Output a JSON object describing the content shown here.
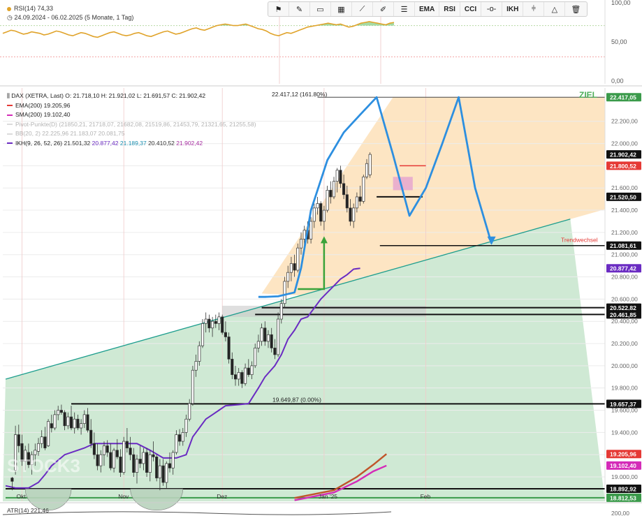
{
  "rsi_panel": {
    "label": "RSI(14)",
    "value": "74,33",
    "range_text": "24.09.2024 - 06.02.2025  (5 Monate, 1 Tag)",
    "levels": [
      "100,00",
      "50,00",
      "0,00"
    ]
  },
  "toolbar": {
    "icons": [
      "flag-icon",
      "pencil-icon",
      "rectangle-icon",
      "pattern-icon",
      "trend-line-icon",
      "brush-icon",
      "lines-icon"
    ],
    "texts": [
      "EMA",
      "RSI",
      "CCI"
    ],
    "icons2": [
      "dash-dot-icon"
    ],
    "texts2": [
      "IKH"
    ],
    "icons3": [
      "level-icon",
      "triangle-icon",
      "trash-icon"
    ]
  },
  "legend": {
    "title": "DAX (XETRA, Last)  O: 21.718,10  H: 21.921,02  L: 21.691,57  C: 21.902,42",
    "ema": "EMA(200)  19.205,96",
    "sma": "SMA(200)  19.102,40",
    "pivot": "Pivot-Punkte(D)  (21850,21,  21718,07,  21682,08,  21519,86,  21453,79,  21321,65,  21255,58)",
    "bb": "BB(20, 2)  22.225,96  21.183,07  20.081,75",
    "ikh_label": "IKH(9, 26, 52, 26)",
    "ikh_vals": [
      "21.501,32",
      "20.877,42",
      "21.189,37",
      "20.410,52",
      "21.902,42"
    ]
  },
  "annotations": {
    "ziel": "ZIEL",
    "fib_top": "22.417,12 (161.80%)",
    "fib_low": "19.649,87 (0.00%)",
    "trendwechsel": "Trendwechsel"
  },
  "atr": {
    "label": "ATR(14)",
    "value": "221,46",
    "scale_top": "200,00"
  },
  "watermark": "STOCK3",
  "colors": {
    "candle_up": "#ffffff",
    "candle_down": "#222222",
    "ikh": "#6a2bc2",
    "ema": "#c0552a",
    "sma": "#d42bb8",
    "projection": "#2d8fe0",
    "green_zone": "#cfe9d4",
    "orange_zone": "#fde2bd",
    "trendline": "#1e9e8e",
    "green_arrow": "#3aa33a",
    "rsi_line": "#e0a32a",
    "rsi_fill": "#8fd28f"
  },
  "chart_data": {
    "type": "candlestick",
    "instrument": "DAX (XETRA, Last)",
    "x_labels": [
      {
        "label": "Okt",
        "d": 5
      },
      {
        "label": "Nov",
        "d": 36
      },
      {
        "label": "Dez",
        "d": 66
      },
      {
        "label": "Jan '25",
        "d": 97
      },
      {
        "label": "Feb",
        "d": 128
      }
    ],
    "y_ticks": [
      19000,
      19200,
      19400,
      19600,
      19800,
      20000,
      20200,
      20400,
      20600,
      20800,
      21000,
      21200,
      21400,
      21600,
      21800,
      22000,
      22200
    ],
    "ylim": [
      18780,
      22500
    ],
    "price_tags": [
      {
        "label": "22.417,05",
        "value": 22417.05,
        "bg": "#3a9a4a",
        "fg": "#ffffff"
      },
      {
        "label": "21.902,42",
        "value": 21902.42,
        "bg": "#111111",
        "fg": "#ffffff"
      },
      {
        "label": "21.800,52",
        "value": 21800.52,
        "bg": "#e53935",
        "fg": "#ffffff"
      },
      {
        "label": "21.520,50",
        "value": 21520.5,
        "bg": "#111111",
        "fg": "#ffffff"
      },
      {
        "label": "21.081,61",
        "value": 21081.61,
        "bg": "#111111",
        "fg": "#ffffff"
      },
      {
        "label": "20.877,42",
        "value": 20877.42,
        "bg": "#6a2bc2",
        "fg": "#ffffff"
      },
      {
        "label": "20.522,82",
        "value": 20522.82,
        "bg": "#111111",
        "fg": "#ffffff"
      },
      {
        "label": "20.461,85",
        "value": 20461.85,
        "bg": "#111111",
        "fg": "#ffffff"
      },
      {
        "label": "19.657,37",
        "value": 19657.37,
        "bg": "#111111",
        "fg": "#ffffff"
      },
      {
        "label": "19.205,96",
        "value": 19205.96,
        "bg": "#e53935",
        "fg": "#ffffff"
      },
      {
        "label": "19.102,40",
        "value": 19102.4,
        "bg": "#d42bb8",
        "fg": "#ffffff"
      },
      {
        "label": "18.892,92",
        "value": 18892.92,
        "bg": "#111111",
        "fg": "#ffffff"
      },
      {
        "label": "18.812,53",
        "value": 18812.53,
        "bg": "#3a9a4a",
        "fg": "#ffffff"
      }
    ],
    "levels": [
      {
        "y": 22417.05,
        "d0": 95,
        "color": "#444444",
        "width": 1
      },
      {
        "y": 21520.5,
        "d0": 113,
        "d1": 127,
        "color": "#111111",
        "width": 2
      },
      {
        "y": 21081.61,
        "d0": 114,
        "color": "#111111",
        "width": 1.5
      },
      {
        "y": 20522.82,
        "d0": 78,
        "color": "#111111",
        "width": 2
      },
      {
        "y": 20461.85,
        "d0": 76,
        "color": "#111111",
        "width": 2
      },
      {
        "y": 19657.37,
        "d0": 20,
        "color": "#111111",
        "width": 2
      },
      {
        "y": 18892.92,
        "d0": 0,
        "color": "#111111",
        "width": 2
      },
      {
        "y": 18812.53,
        "d0": 0,
        "color": "#3a9a4a",
        "width": 2
      },
      {
        "y": 21800.52,
        "d0": 120,
        "d1": 128,
        "color": "#e53935",
        "width": 1.5
      }
    ],
    "candles": [
      [
        2,
        18990,
        19000,
        18880,
        18960
      ],
      [
        3,
        19060,
        19460,
        19020,
        19380
      ],
      [
        4,
        19380,
        19470,
        19220,
        19280
      ],
      [
        5,
        19300,
        19380,
        19100,
        19140
      ],
      [
        6,
        19140,
        19280,
        19060,
        19240
      ],
      [
        7,
        19220,
        19300,
        19080,
        19110
      ],
      [
        8,
        19110,
        19230,
        19020,
        19200
      ],
      [
        9,
        19200,
        19300,
        19100,
        19240
      ],
      [
        10,
        19230,
        19350,
        19190,
        19300
      ],
      [
        11,
        19300,
        19420,
        19260,
        19360
      ],
      [
        12,
        19360,
        19450,
        19240,
        19260
      ],
      [
        13,
        19280,
        19520,
        19270,
        19500
      ],
      [
        14,
        19480,
        19560,
        19400,
        19440
      ],
      [
        15,
        19440,
        19600,
        19420,
        19560
      ],
      [
        16,
        19560,
        19640,
        19510,
        19600
      ],
      [
        17,
        19600,
        19650,
        19560,
        19580
      ],
      [
        18,
        19580,
        19600,
        19420,
        19460
      ],
      [
        19,
        19460,
        19580,
        19430,
        19540
      ],
      [
        20,
        19540,
        19640,
        19420,
        19440
      ],
      [
        21,
        19440,
        19580,
        19390,
        19520
      ],
      [
        22,
        19520,
        19560,
        19420,
        19440
      ],
      [
        23,
        19440,
        19520,
        19380,
        19480
      ],
      [
        24,
        19480,
        19600,
        19440,
        19560
      ],
      [
        25,
        19560,
        19620,
        19400,
        19420
      ],
      [
        26,
        19420,
        19520,
        19260,
        19300
      ],
      [
        27,
        19300,
        19400,
        19160,
        19200
      ],
      [
        28,
        19200,
        19300,
        19060,
        19100
      ],
      [
        29,
        19100,
        19240,
        19040,
        19200
      ],
      [
        30,
        19200,
        19320,
        19100,
        19280
      ],
      [
        31,
        19280,
        19330,
        19180,
        19220
      ],
      [
        32,
        19220,
        19300,
        19060,
        19080
      ],
      [
        33,
        19080,
        19260,
        19040,
        19240
      ],
      [
        34,
        19240,
        19340,
        19160,
        19180
      ],
      [
        35,
        19180,
        19250,
        19000,
        19040
      ],
      [
        36,
        19040,
        19360,
        19020,
        19320
      ],
      [
        37,
        19320,
        19440,
        19220,
        19260
      ],
      [
        38,
        19260,
        19360,
        19150,
        19200
      ],
      [
        39,
        19200,
        19260,
        19000,
        19040
      ],
      [
        40,
        19040,
        19200,
        18940,
        19160
      ],
      [
        41,
        19160,
        19280,
        19080,
        19120
      ],
      [
        42,
        19120,
        19260,
        19060,
        19220
      ],
      [
        43,
        19220,
        19260,
        19000,
        19040
      ],
      [
        44,
        19040,
        19240,
        18960,
        19200
      ],
      [
        45,
        19200,
        19320,
        19140,
        19180
      ],
      [
        46,
        19180,
        19200,
        18960,
        18990
      ],
      [
        47,
        18990,
        19160,
        18880,
        19100
      ],
      [
        48,
        19100,
        19160,
        18920,
        18950
      ],
      [
        49,
        18950,
        19140,
        18900,
        19120
      ],
      [
        50,
        19120,
        19220,
        19040,
        19080
      ],
      [
        51,
        19080,
        19240,
        19020,
        19220
      ],
      [
        52,
        19220,
        19420,
        19200,
        19380
      ],
      [
        53,
        19380,
        19430,
        19280,
        19320
      ],
      [
        54,
        19320,
        19440,
        19280,
        19400
      ],
      [
        55,
        19400,
        19560,
        19360,
        19520
      ],
      [
        56,
        19520,
        19700,
        19500,
        19660
      ],
      [
        57,
        19660,
        20000,
        19640,
        19960
      ],
      [
        58,
        19960,
        20100,
        19900,
        20040
      ],
      [
        59,
        20040,
        20220,
        20000,
        20180
      ],
      [
        60,
        20180,
        20420,
        20160,
        20380
      ],
      [
        61,
        20380,
        20480,
        20300,
        20420
      ],
      [
        62,
        20420,
        20460,
        20300,
        20340
      ],
      [
        63,
        20340,
        20440,
        20260,
        20400
      ],
      [
        64,
        20400,
        20460,
        20340,
        20380
      ],
      [
        65,
        20380,
        20480,
        20320,
        20440
      ],
      [
        66,
        20440,
        20460,
        20280,
        20300
      ],
      [
        67,
        20300,
        20400,
        20220,
        20260
      ],
      [
        68,
        20260,
        20300,
        20020,
        20060
      ],
      [
        69,
        20060,
        20120,
        19880,
        19920
      ],
      [
        70,
        19920,
        20000,
        19820,
        19880
      ],
      [
        71,
        19880,
        19980,
        19820,
        19940
      ],
      [
        72,
        19940,
        19960,
        19800,
        19840
      ],
      [
        73,
        19840,
        20020,
        19820,
        19980
      ],
      [
        74,
        19980,
        20060,
        19900,
        19920
      ],
      [
        75,
        19920,
        20040,
        19880,
        20000
      ],
      [
        76,
        20000,
        20200,
        19980,
        20160
      ],
      [
        77,
        20160,
        20280,
        20120,
        20220
      ],
      [
        78,
        20220,
        20380,
        20180,
        20340
      ],
      [
        79,
        20340,
        20400,
        20180,
        20220
      ],
      [
        80,
        20220,
        20320,
        20160,
        20280
      ],
      [
        81,
        20280,
        20340,
        20120,
        20160
      ],
      [
        82,
        20160,
        20240,
        20060,
        20100
      ],
      [
        83,
        20100,
        20480,
        20080,
        20420
      ],
      [
        84,
        20420,
        20600,
        20380,
        20560
      ],
      [
        85,
        20560,
        20800,
        20520,
        20760
      ],
      [
        86,
        20760,
        20900,
        20700,
        20840
      ],
      [
        87,
        20840,
        20980,
        20760,
        20920
      ],
      [
        88,
        20920,
        21000,
        20800,
        20860
      ],
      [
        89,
        20860,
        21100,
        20840,
        21060
      ],
      [
        90,
        21060,
        21200,
        21000,
        21140
      ],
      [
        91,
        21140,
        21260,
        21060,
        21220
      ],
      [
        92,
        21220,
        21300,
        21100,
        21140
      ],
      [
        93,
        21140,
        21340,
        21100,
        21300
      ],
      [
        94,
        21300,
        21460,
        21240,
        21420
      ],
      [
        95,
        21420,
        21520,
        21360,
        21460
      ],
      [
        96,
        21460,
        21480,
        21260,
        21300
      ],
      [
        97,
        21300,
        21440,
        21220,
        21400
      ],
      [
        98,
        21400,
        21620,
        21380,
        21580
      ],
      [
        99,
        21580,
        21660,
        21460,
        21520
      ],
      [
        100,
        21520,
        21700,
        21500,
        21660
      ],
      [
        101,
        21660,
        21780,
        21560,
        21760
      ],
      [
        102,
        21760,
        21800,
        21600,
        21640
      ],
      [
        103,
        21640,
        21720,
        21500,
        21540
      ],
      [
        104,
        21540,
        21620,
        21380,
        21420
      ],
      [
        105,
        21420,
        21500,
        21260,
        21300
      ],
      [
        106,
        21300,
        21460,
        21240,
        21420
      ],
      [
        107,
        21420,
        21560,
        21380,
        21520
      ],
      [
        108,
        21520,
        21620,
        21440,
        21480
      ],
      [
        109,
        21480,
        21720,
        21460,
        21700
      ],
      [
        110,
        21700,
        21860,
        21680,
        21820
      ],
      [
        111,
        21718.1,
        21921.02,
        21691.57,
        21902.42
      ]
    ],
    "ikh_line": [
      [
        0,
        18920
      ],
      [
        3,
        18900
      ],
      [
        7,
        18900
      ],
      [
        10,
        18950
      ],
      [
        12,
        19020
      ],
      [
        14,
        19100
      ],
      [
        18,
        19200
      ],
      [
        24,
        19260
      ],
      [
        27,
        19300
      ],
      [
        30,
        19300
      ],
      [
        40,
        19300
      ],
      [
        44,
        19240
      ],
      [
        48,
        19170
      ],
      [
        52,
        19170
      ],
      [
        55,
        19200
      ],
      [
        57,
        19360
      ],
      [
        59,
        19440
      ],
      [
        61,
        19520
      ],
      [
        63,
        19560
      ],
      [
        65,
        19600
      ],
      [
        67,
        19640
      ],
      [
        71,
        19650
      ],
      [
        74,
        19660
      ],
      [
        77,
        19800
      ],
      [
        79,
        19900
      ],
      [
        82,
        20000
      ],
      [
        84,
        20100
      ],
      [
        86,
        20240
      ],
      [
        88,
        20320
      ],
      [
        90,
        20420
      ],
      [
        92,
        20440
      ],
      [
        94,
        20520
      ],
      [
        96,
        20600
      ],
      [
        98,
        20660
      ],
      [
        100,
        20720
      ],
      [
        102,
        20780
      ],
      [
        104,
        20820
      ],
      [
        106,
        20870
      ],
      [
        108,
        20877
      ]
    ],
    "ema_line": [
      [
        88,
        18810
      ],
      [
        100,
        18880
      ],
      [
        107,
        19000
      ],
      [
        112,
        19110
      ],
      [
        116,
        19206
      ]
    ],
    "sma_line": [
      [
        88,
        18790
      ],
      [
        100,
        18860
      ],
      [
        107,
        18960
      ],
      [
        112,
        19050
      ],
      [
        116,
        19102
      ]
    ],
    "trendline": [
      [
        0,
        19880
      ],
      [
        172,
        21320
      ]
    ],
    "projection": [
      [
        -6,
        20620
      ],
      [
        -4,
        20620
      ],
      [
        0,
        20625
      ],
      [
        5,
        20660
      ],
      [
        7,
        20880
      ],
      [
        10,
        21400
      ],
      [
        15,
        21850
      ],
      [
        20,
        22100
      ],
      [
        25,
        22260
      ],
      [
        30,
        22417
      ],
      [
        35,
        21900
      ],
      [
        40,
        21350
      ],
      [
        45,
        21600
      ],
      [
        50,
        22000
      ],
      [
        55,
        22417
      ],
      [
        60,
        21600
      ],
      [
        65,
        21100
      ]
    ],
    "projection_d0": 83,
    "projection_d_step": 1,
    "fib_zone": {
      "d0": 78,
      "d1": 172,
      "y_low": 20650,
      "y_high": 22417
    },
    "pink_box": {
      "d0": 118,
      "d1": 124,
      "y0": 21580,
      "y1": 21700
    },
    "grey_box": {
      "d0": 66,
      "d1": 128,
      "y0": 20440,
      "y1": 20540
    }
  },
  "rsi_data": {
    "values": [
      60,
      62,
      64,
      63,
      61,
      59,
      60,
      62,
      61,
      60,
      58,
      59,
      61,
      63,
      62,
      60,
      58,
      57,
      59,
      61,
      60,
      58,
      56,
      55,
      57,
      59,
      61,
      62,
      60,
      58,
      57,
      58,
      60,
      61,
      59,
      57,
      56,
      58,
      60,
      62,
      63,
      61,
      59,
      60,
      62,
      64,
      66,
      67,
      65,
      64,
      66,
      68,
      70,
      71,
      72,
      71,
      70,
      70,
      71,
      72,
      70,
      68,
      66,
      65,
      63,
      60,
      58,
      57,
      59,
      61,
      60,
      62,
      64,
      66,
      68,
      69,
      70,
      71,
      72,
      73,
      72,
      71,
      72,
      70,
      68,
      69,
      71,
      73,
      74,
      75,
      74,
      73,
      72,
      71,
      73,
      74
    ]
  }
}
